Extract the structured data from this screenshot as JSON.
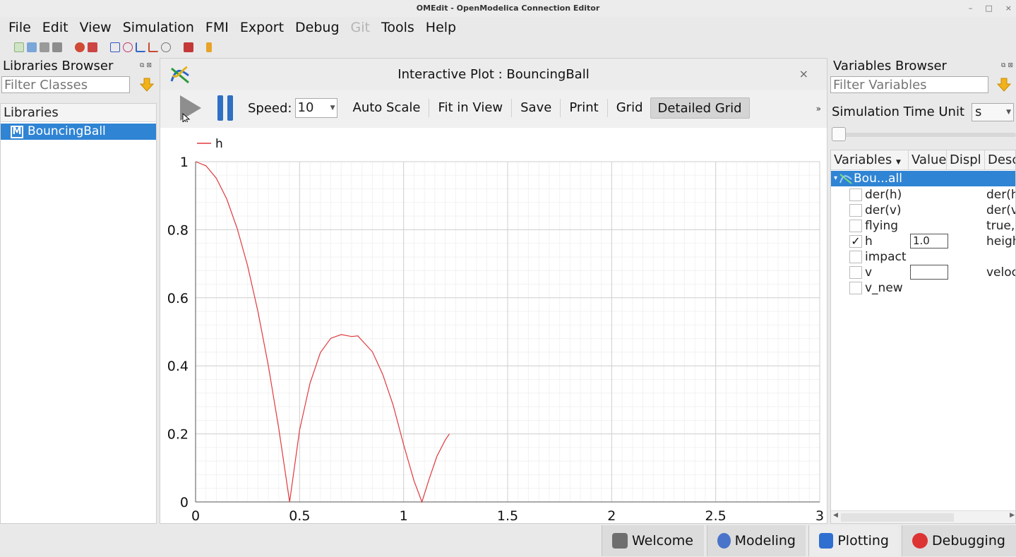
{
  "window": {
    "title": "OMEdit - OpenModelica Connection Editor"
  },
  "menu": [
    "File",
    "Edit",
    "View",
    "Simulation",
    "FMI",
    "Export",
    "Debug",
    "Git",
    "Tools",
    "Help"
  ],
  "libraries_browser": {
    "title": "Libraries Browser",
    "filter_placeholder": "Filter Classes",
    "header": "Libraries",
    "item": "BouncingBall",
    "item_badge": "M"
  },
  "plot_window": {
    "title": "Interactive Plot : BouncingBall",
    "speed_label": "Speed:",
    "speed_value": "10",
    "buttons": [
      "Auto Scale",
      "Fit in View",
      "Save",
      "Print",
      "Grid",
      "Detailed Grid"
    ],
    "more": "»",
    "close": "×"
  },
  "variables_browser": {
    "title": "Variables Browser",
    "filter_placeholder": "Filter Variables",
    "sim_time_unit_label": "Simulation Time Unit",
    "sim_time_unit_value": "s",
    "columns": [
      "Variables",
      "Value",
      "Displ",
      "Desc"
    ],
    "root": "Bou...all",
    "rows": [
      {
        "name": "der(h)",
        "checked": false,
        "value": null,
        "desc": "der(h"
      },
      {
        "name": "der(v)",
        "checked": false,
        "value": null,
        "desc": "der(v"
      },
      {
        "name": "flying",
        "checked": false,
        "value": null,
        "desc": "true,"
      },
      {
        "name": "h",
        "checked": true,
        "value": "1.0",
        "desc": "heigh"
      },
      {
        "name": "impact",
        "checked": false,
        "value": null,
        "desc": ""
      },
      {
        "name": "v",
        "checked": false,
        "value": "",
        "desc": "veloc"
      },
      {
        "name": "v_new",
        "checked": false,
        "value": null,
        "desc": ""
      }
    ]
  },
  "perspectives": [
    "Welcome",
    "Modeling",
    "Plotting",
    "Debugging"
  ],
  "chart_data": {
    "type": "line",
    "title": "",
    "xlabel": "",
    "ylabel": "",
    "xlim": [
      0,
      3
    ],
    "ylim": [
      0,
      1
    ],
    "x_ticks": [
      "0",
      "0.5",
      "1",
      "1.5",
      "2",
      "2.5",
      "3"
    ],
    "y_ticks": [
      "0",
      "0.2",
      "0.4",
      "0.6",
      "0.8",
      "1"
    ],
    "grid": true,
    "legend": "top-left",
    "series": [
      {
        "name": "h",
        "color": "#e0393e",
        "x": [
          0,
          0.05,
          0.1,
          0.15,
          0.2,
          0.25,
          0.3,
          0.35,
          0.4,
          0.452,
          0.5,
          0.55,
          0.6,
          0.65,
          0.7,
          0.75,
          0.78,
          0.85,
          0.9,
          0.95,
          1.0,
          1.05,
          1.088,
          1.12,
          1.16,
          1.2,
          1.22
        ],
        "y": [
          1.0,
          0.988,
          0.951,
          0.89,
          0.804,
          0.694,
          0.559,
          0.4,
          0.215,
          0.0,
          0.211,
          0.349,
          0.439,
          0.481,
          0.492,
          0.486,
          0.488,
          0.441,
          0.374,
          0.284,
          0.168,
          0.062,
          0.0,
          0.062,
          0.134,
          0.182,
          0.2
        ]
      }
    ]
  }
}
